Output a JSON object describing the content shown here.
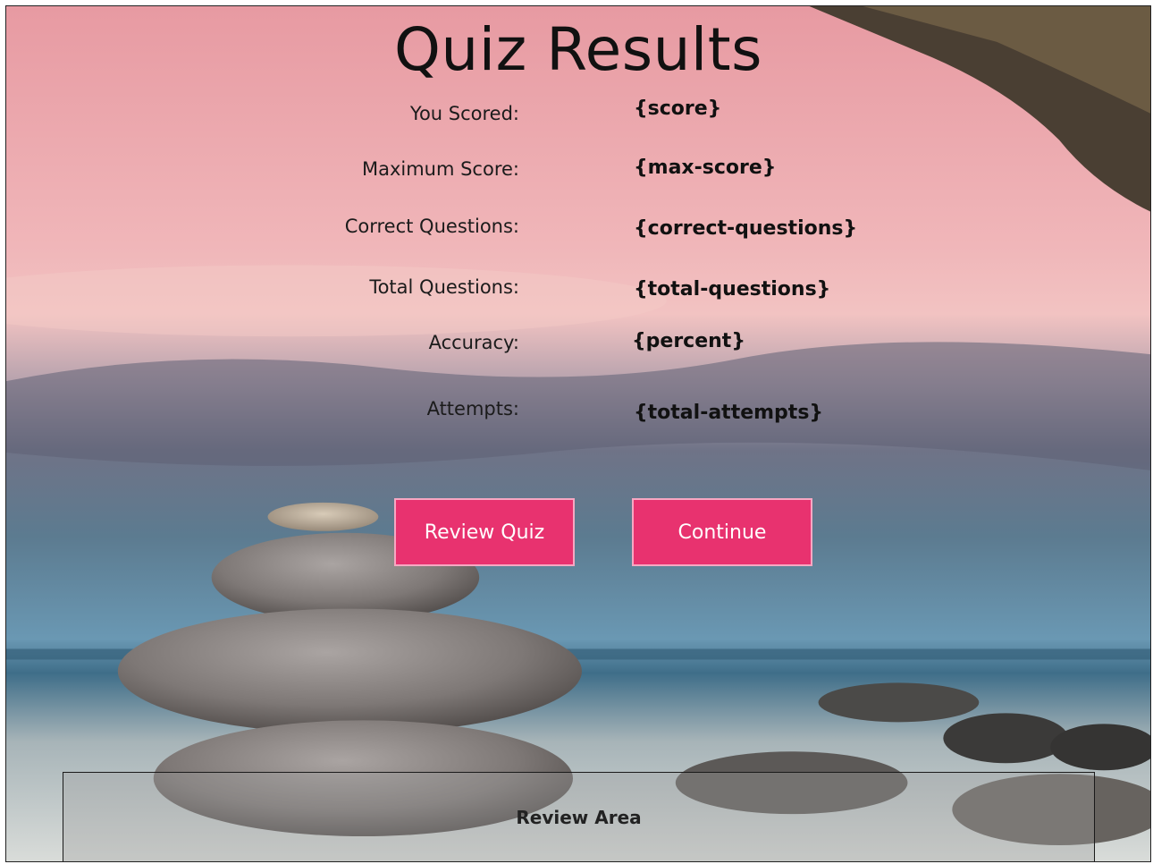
{
  "title": "Quiz Results",
  "rows": [
    {
      "label": "You Scored:",
      "value": "{score}"
    },
    {
      "label": "Maximum Score:",
      "value": "{max-score}"
    },
    {
      "label": "Correct Questions:",
      "value": "{correct-questions}"
    },
    {
      "label": "Total Questions:",
      "value": "{total-questions}"
    },
    {
      "label": "Accuracy:",
      "value": "{percent}"
    },
    {
      "label": "Attempts:",
      "value": "{total-attempts}"
    }
  ],
  "buttons": {
    "review": "Review Quiz",
    "continue": "Continue"
  },
  "review_area": {
    "label": "Review Area"
  },
  "colors": {
    "button": "#e8326f",
    "sky_top": "#e9a7b0",
    "sea": "#5a86a0"
  }
}
